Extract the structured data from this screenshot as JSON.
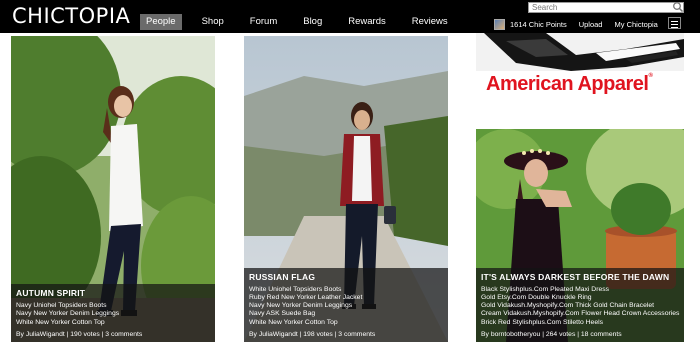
{
  "header": {
    "logo": "CHICTOPIA",
    "nav": [
      "People",
      "Shop",
      "Forum",
      "Blog",
      "Rewards",
      "Reviews"
    ],
    "search_placeholder": "Search",
    "points": "1614 Chic Points",
    "upload": "Upload",
    "my_chictopia": "My Chictopia"
  },
  "ad": {
    "brand": "American Apparel",
    "mark": "®"
  },
  "cards": [
    {
      "title": "AUTUMN SPIRIT",
      "items": [
        "Navy Uniohel Topsiders Boots",
        "Navy New Yorker Denim Leggings",
        "White New Yorker Cotton Top"
      ],
      "byline": "By JuliaWigandt | 190 votes | 3 comments"
    },
    {
      "title": "RUSSIAN FLAG",
      "items": [
        "White Uniohel Topsiders Boots",
        "Ruby Red New Yorker Leather Jacket",
        "Navy New Yorker Denim Leggings",
        "Navy ASK Suede Bag",
        "White New Yorker Cotton Top"
      ],
      "byline": "By JuliaWigandt | 198 votes | 3 comments"
    },
    {
      "title": "IT'S ALWAYS DARKEST BEFORE THE DAWN",
      "items": [
        "Black Stylishplus.Com Pleated Maxi Dress",
        "Gold Etsy.Com Double Knuckle Ring",
        "Gold Vidakush.Myshopify.Com Thick Gold Chain Bracelet",
        "Cream Vidakush.Myshopify.Com Flower Head Crown Accessories",
        "Brick Red Stylishplus.Com Stiletto Heels"
      ],
      "byline": "By borntobotheryou | 264 votes | 18 comments"
    }
  ],
  "colors": {
    "bar": "#000000",
    "active_tab": "#6b6b6b",
    "ad_red": "#e0141f"
  }
}
